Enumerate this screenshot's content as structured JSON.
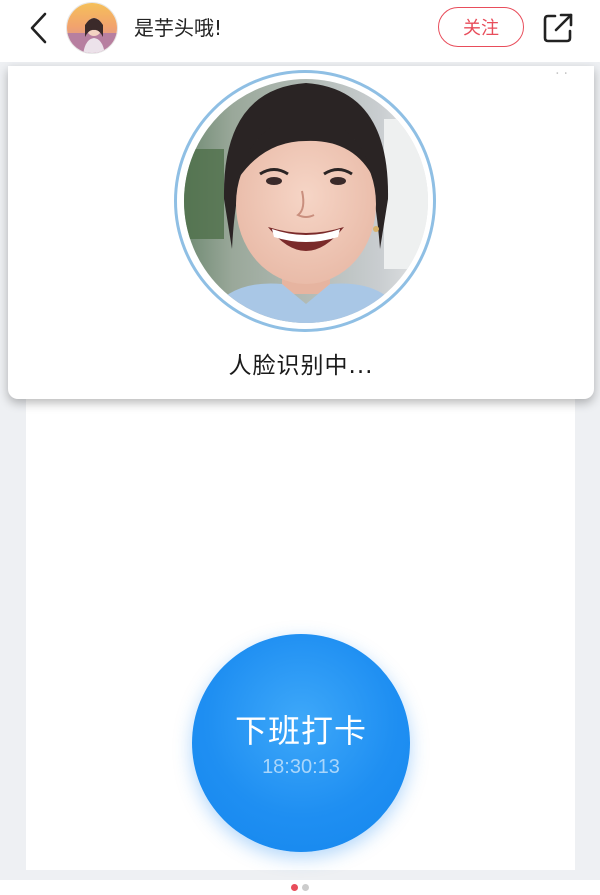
{
  "header": {
    "username": "是芋头哦!",
    "follow_label": "关注",
    "back_icon": "chevron-left-icon",
    "share_icon": "external-share-icon"
  },
  "face_card": {
    "status_text": "人脸识别中..."
  },
  "clock_button": {
    "label": "下班打卡",
    "time": "18:30:13"
  },
  "pager": {
    "current": 1,
    "total": 2
  },
  "colors": {
    "accent_red": "#e84d5b",
    "button_blue": "#1f8ff2",
    "time_light_blue": "#a9d6fb",
    "page_bg": "#eef0f3",
    "ring_blue": "#8fbfe4"
  }
}
